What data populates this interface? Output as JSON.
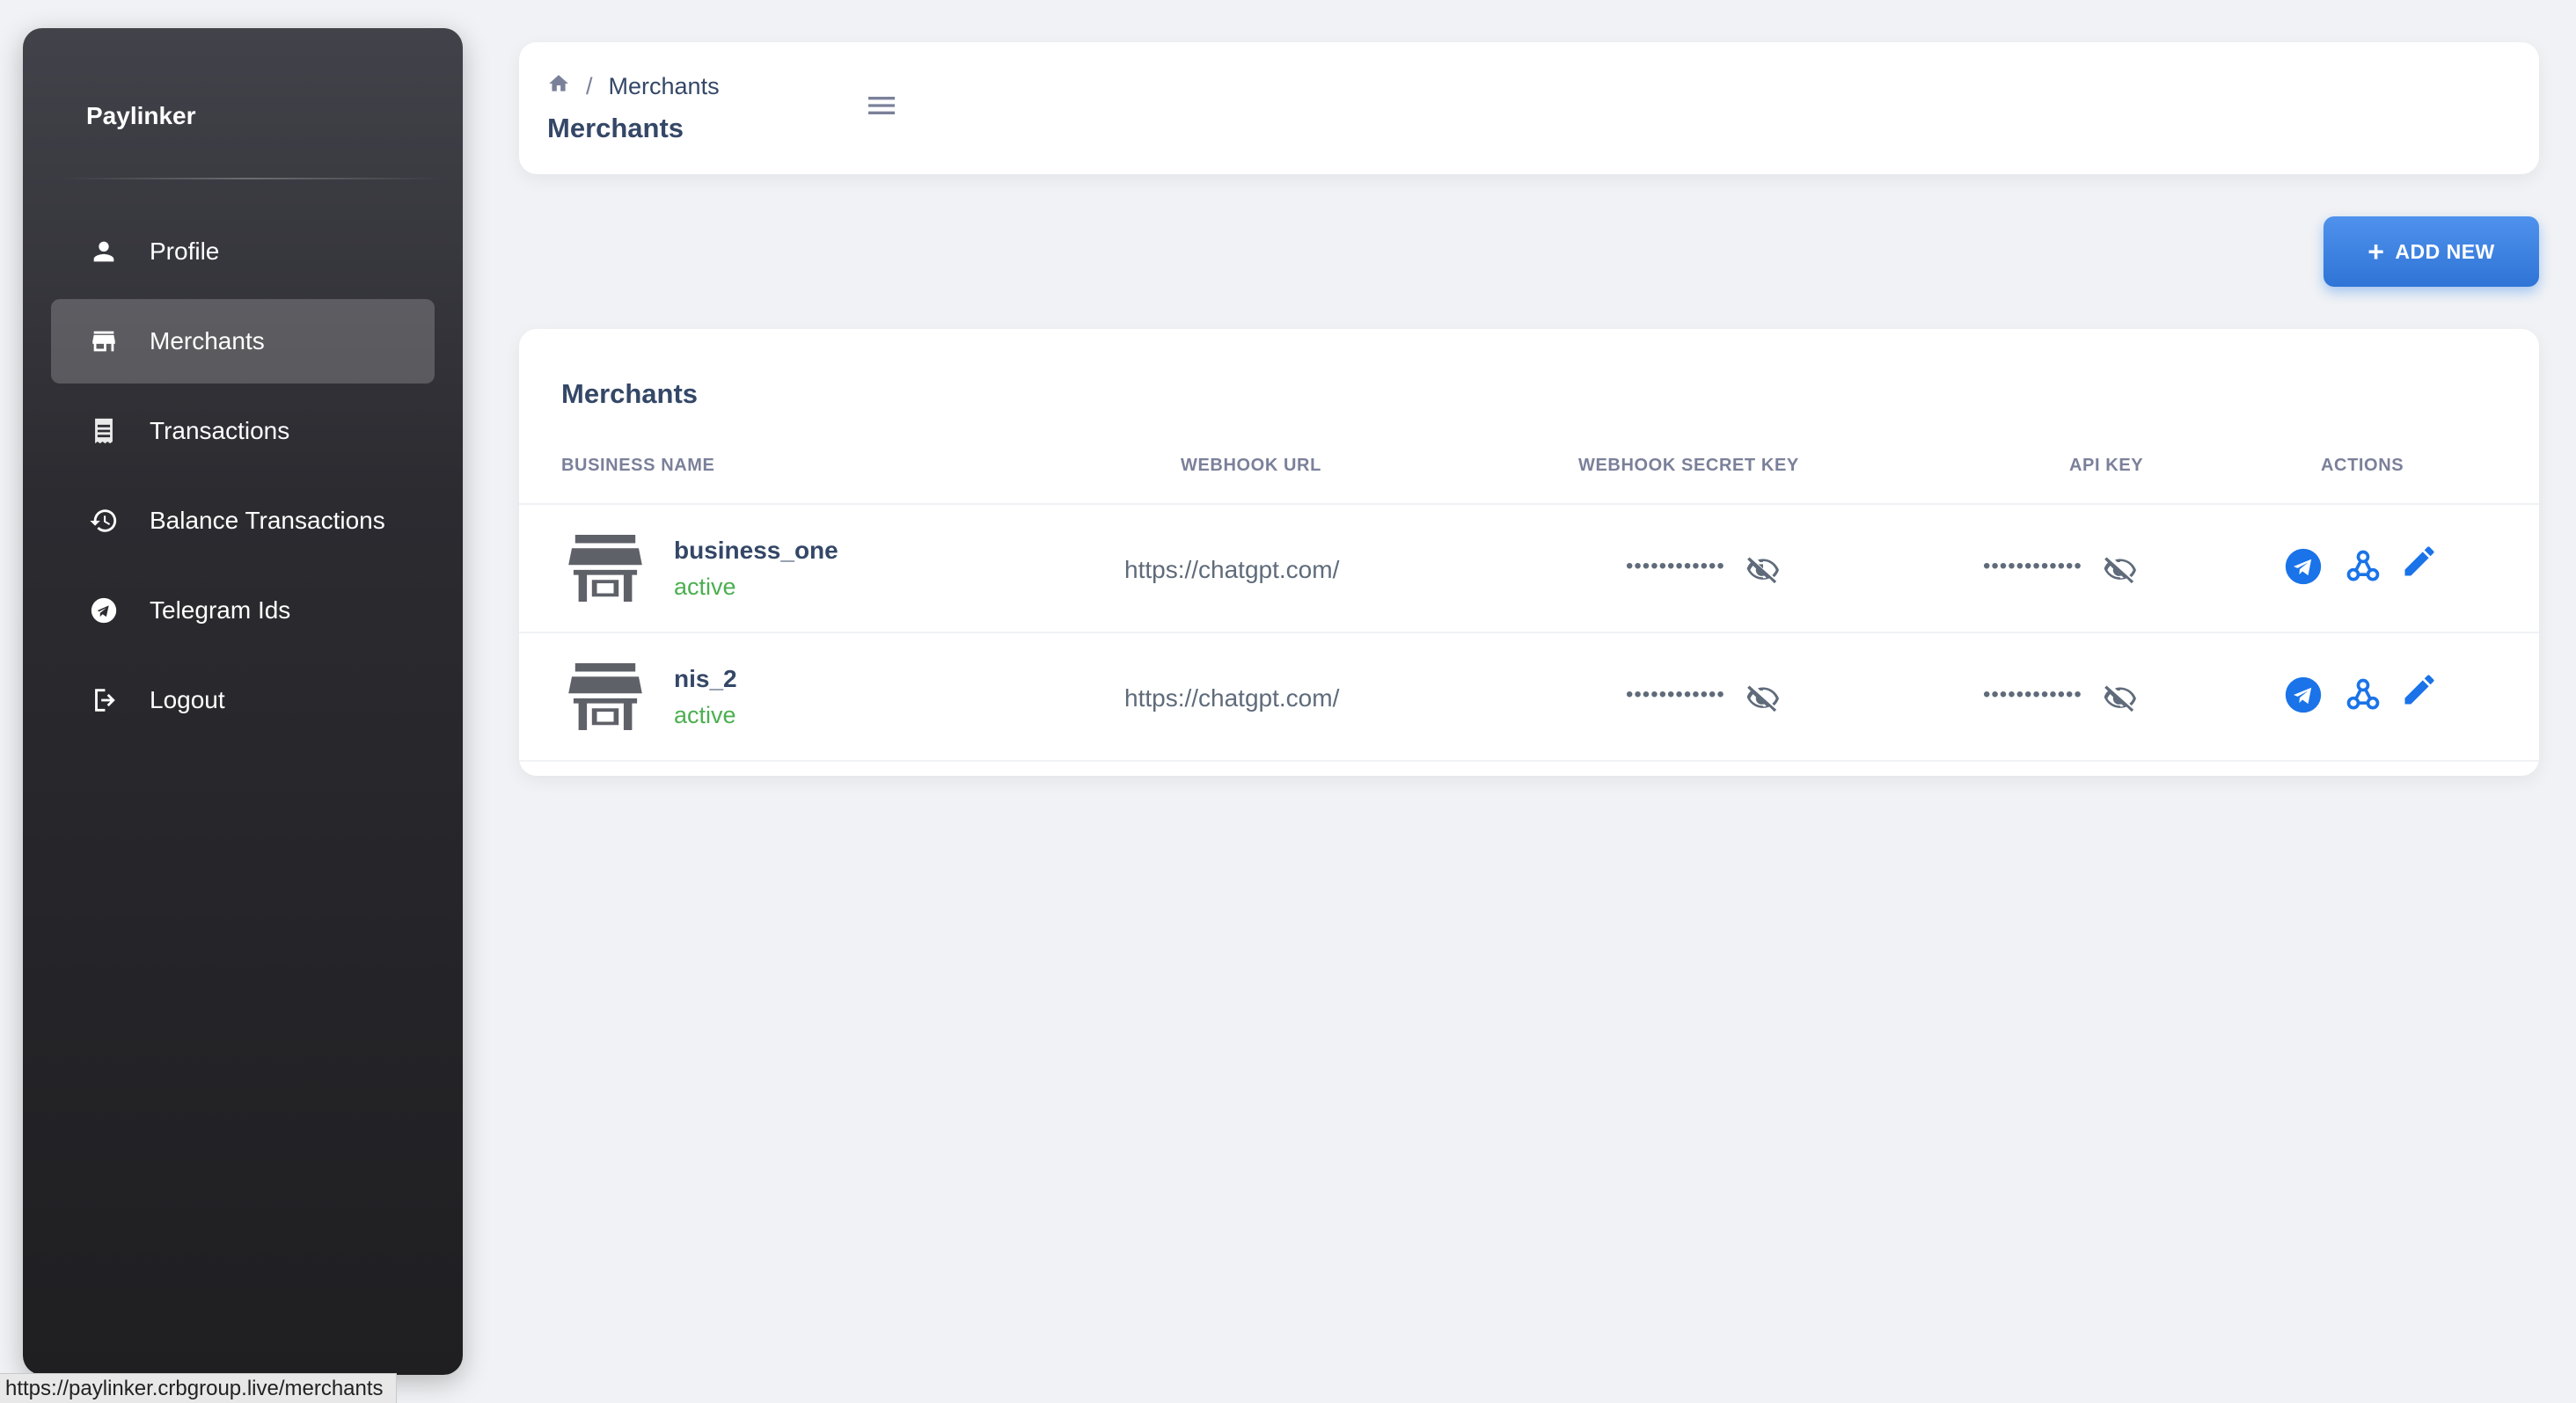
{
  "app": {
    "brand": "Paylinker"
  },
  "sidebar": {
    "items": [
      {
        "label": "Profile",
        "icon": "person-icon"
      },
      {
        "label": "Merchants",
        "icon": "store-icon",
        "active": true
      },
      {
        "label": "Transactions",
        "icon": "receipt-icon"
      },
      {
        "label": "Balance Transactions",
        "icon": "history-icon"
      },
      {
        "label": "Telegram Ids",
        "icon": "telegram-icon"
      },
      {
        "label": "Logout",
        "icon": "logout-icon"
      }
    ]
  },
  "header": {
    "breadcrumb": {
      "current": "Merchants",
      "separator": "/"
    },
    "title": "Merchants"
  },
  "actions": {
    "add_new_label": "ADD NEW",
    "add_new_icon": "+"
  },
  "table": {
    "title": "Merchants",
    "columns": [
      "BUSINESS NAME",
      "WEBHOOK URL",
      "WEBHOOK SECRET KEY",
      "API KEY",
      "ACTIONS"
    ],
    "rows": [
      {
        "name": "business_one",
        "status": "active",
        "webhook_url": "https://chatgpt.com/",
        "secret": "••••••••••••",
        "api_key": "••••••••••••"
      },
      {
        "name": "nis_2",
        "status": "active",
        "webhook_url": "https://chatgpt.com/",
        "secret": "••••••••••••",
        "api_key": "••••••••••••"
      }
    ]
  },
  "statusbar": {
    "url": "https://paylinker.crbgroup.live/merchants"
  },
  "colors": {
    "accent": "#1a73e8",
    "status_active": "#4caf50",
    "sidebar_dark": "#1f1f22"
  }
}
